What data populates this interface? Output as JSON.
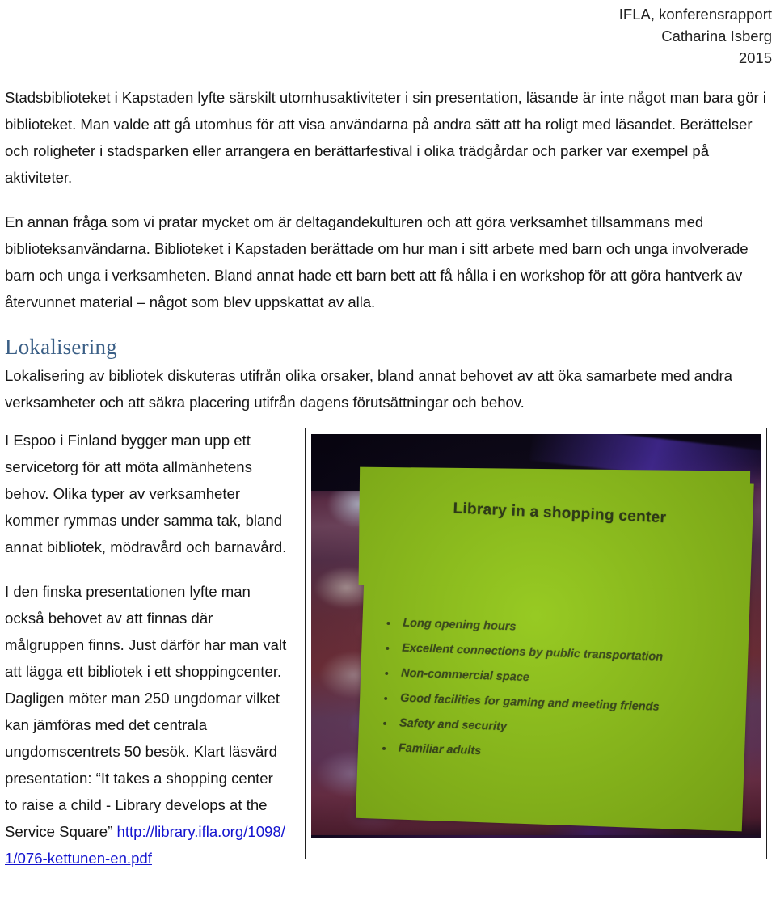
{
  "header": {
    "lines": [
      "IFLA, konferensrapport",
      "Catharina Isberg",
      "2015"
    ]
  },
  "body": {
    "paragraph1": "Stadsbiblioteket i Kapstaden lyfte särskilt utomhusaktiviteter i sin presentation, läsande är inte något man bara gör i biblioteket. Man valde att gå utomhus för att visa användarna på andra sätt att ha roligt med läsandet. Berättelser och roligheter i stadsparken eller arrangera en berättarfestival i olika trädgårdar och parker var exempel på aktiviteter.",
    "paragraph2": "En annan fråga som vi pratar mycket om är deltagandekulturen och att göra verksamhet tillsammans med biblioteksanvändarna. Biblioteket i Kapstaden berättade om hur man i sitt arbete med barn och unga involverade barn och unga i verksamheten. Bland annat hade ett barn bett att få hålla i en workshop för att göra hantverk av återvunnet material – något som blev uppskattat av alla.",
    "section_heading": "Lokalisering",
    "paragraph3": "Lokalisering av bibliotek diskuteras utifrån olika orsaker, bland annat behovet av att öka samarbete med andra verksamheter och att säkra placering utifrån dagens förutsättningar och behov."
  },
  "left_column": {
    "paragraph1": "I Espoo i Finland bygger man upp ett servicetorg för att möta allmänhetens behov. Olika typer av verksamheter kommer rymmas under samma tak, bland annat bibliotek, mödravård och barnavård.",
    "paragraph2_before_link": "I den finska presentationen lyfte man också behovet av att finnas där målgruppen finns. Just därför har man valt att lägga ett bibliotek i ett shoppingcenter. Dagligen möter man 250 ungdomar vilket kan jämföras med det centrala ungdomscentrets 50 besök. Klart läsvärd presentation: “It takes a shopping center to raise a child - Library develops at the Service Square” ",
    "link_text": "http://library.ifla.org/1098/1/076-kettunen-en.pdf"
  },
  "photo": {
    "caption_semantics": "projected-presentation-slide-photo",
    "slide": {
      "title": "Library in a shopping center",
      "bullets": [
        "Long opening hours",
        "Excellent connections by public transportation",
        "Non-commercial space",
        "Good facilities for gaming and meeting friends",
        "Safety and security",
        "Familiar adults"
      ],
      "background_color": "#93c81a",
      "text_color": "#3a4a18"
    }
  },
  "colors": {
    "heading_blue": "#3b5f86",
    "link_blue": "#1414cf",
    "body_text": "#161616",
    "slide_green": "#93c81a"
  }
}
